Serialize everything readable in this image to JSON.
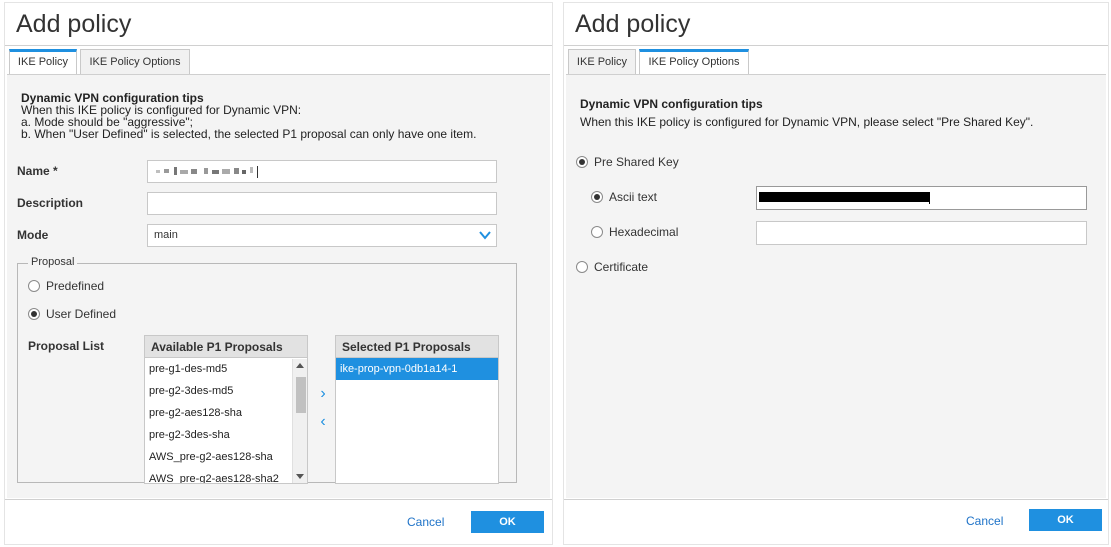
{
  "left_dialog": {
    "title": "Add policy",
    "tabs": [
      {
        "label": "IKE Policy",
        "active": true
      },
      {
        "label": "IKE Policy Options",
        "active": false
      }
    ],
    "tips": {
      "title": "Dynamic VPN configuration tips",
      "lines": [
        "When this IKE policy is configured for Dynamic VPN:",
        "a. Mode should be \"aggressive\";",
        "b. When \"User Defined\" is selected, the selected P1 proposal can only have one item."
      ]
    },
    "name": {
      "label": "Name *",
      "value": ""
    },
    "description": {
      "label": "Description",
      "value": ""
    },
    "mode": {
      "label": "Mode",
      "value": "main"
    },
    "proposal": {
      "legend": "Proposal",
      "options": [
        {
          "label": "Predefined",
          "checked": false
        },
        {
          "label": "User Defined",
          "checked": true
        }
      ],
      "list_label": "Proposal List",
      "available": {
        "header": "Available P1 Proposals",
        "items": [
          "pre-g1-des-md5",
          "pre-g2-3des-md5",
          "pre-g2-aes128-sha",
          "pre-g2-3des-sha",
          "AWS_pre-g2-aes128-sha",
          "AWS_pre-g2-aes128-sha2"
        ]
      },
      "selected": {
        "header": "Selected P1 Proposals",
        "items": [
          "ike-prop-vpn-0db1a14-1"
        ]
      },
      "move_right": "›",
      "move_left": "‹"
    },
    "footer": {
      "cancel": "Cancel",
      "ok": "OK"
    }
  },
  "right_dialog": {
    "title": "Add policy",
    "tabs": [
      {
        "label": "IKE Policy",
        "active": false
      },
      {
        "label": "IKE Policy Options",
        "active": true
      }
    ],
    "tips": {
      "title": "Dynamic VPN configuration tips",
      "line": "When this IKE policy is configured for Dynamic VPN, please select \"Pre Shared Key\"."
    },
    "auth": {
      "pre_shared_key": {
        "label": "Pre Shared Key",
        "checked": true
      },
      "ascii_text": {
        "label": "Ascii text",
        "checked": true
      },
      "hexadecimal": {
        "label": "Hexadecimal",
        "checked": false
      },
      "certificate": {
        "label": "Certificate",
        "checked": false
      }
    },
    "footer": {
      "cancel": "Cancel",
      "ok": "OK"
    }
  },
  "colors": {
    "accent": "#1f90e0",
    "link": "#1f73c8",
    "panel": "#f4f4f4"
  },
  "icons": {
    "chevron": "chevron-down-icon",
    "move_right": "chevron-right-icon",
    "move_left": "chevron-left-icon"
  }
}
